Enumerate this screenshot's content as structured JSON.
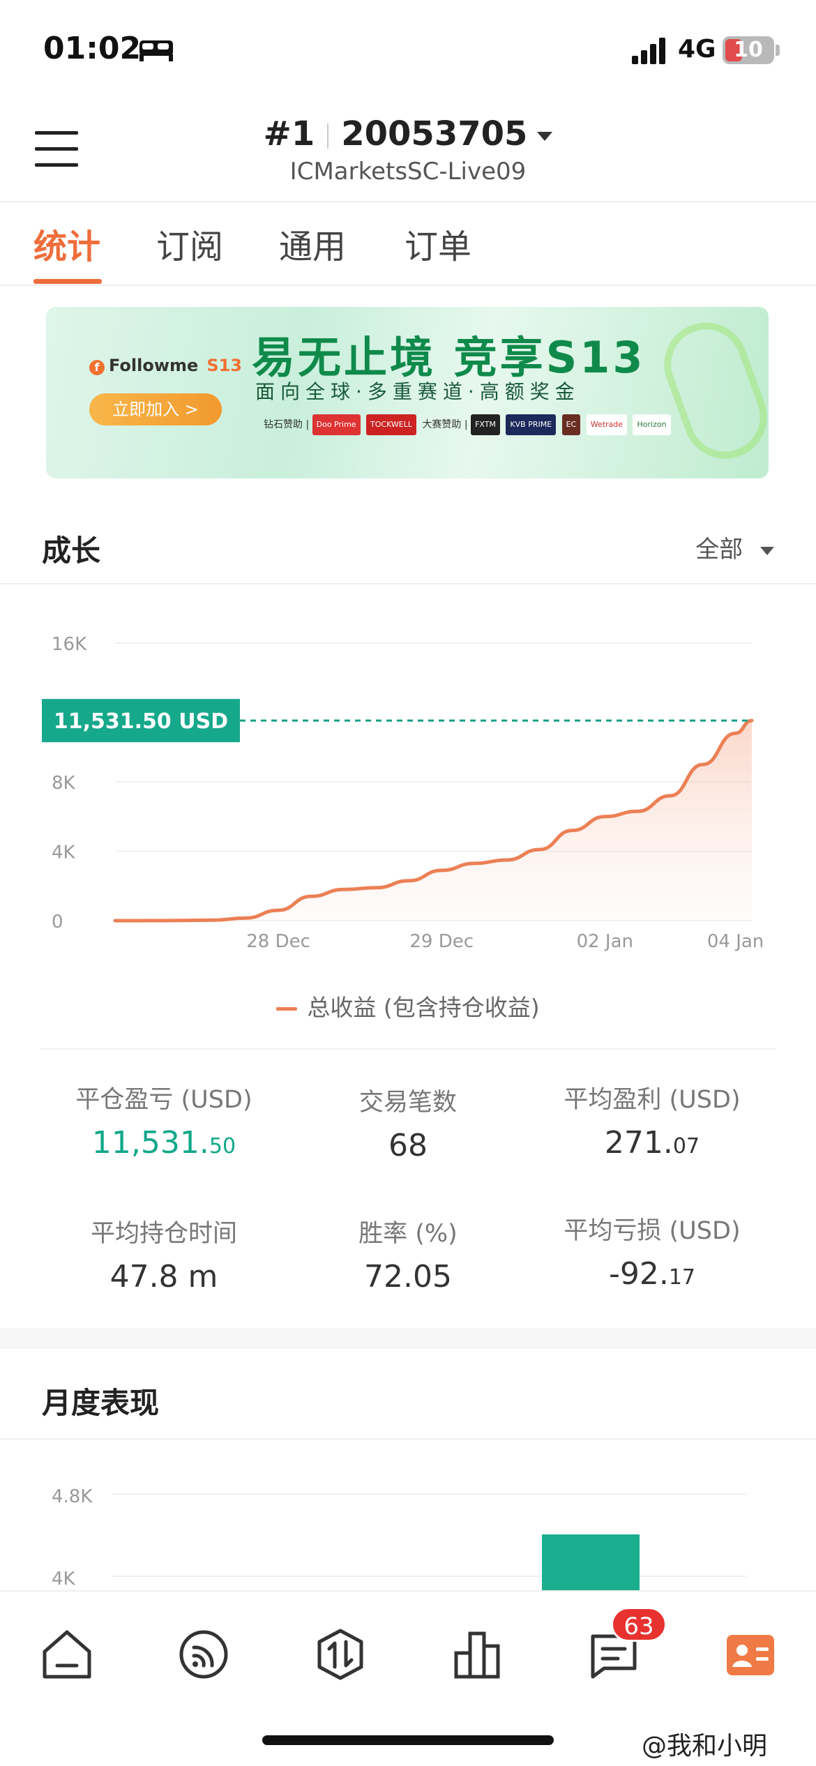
{
  "status_bar": {
    "time": "01:02",
    "network": "4G",
    "battery": "10"
  },
  "header": {
    "rank": "#1",
    "account": "20053705",
    "server": "ICMarketsSC-Live09"
  },
  "tabs": [
    {
      "label": "统计",
      "active": true
    },
    {
      "label": "订阅",
      "active": false
    },
    {
      "label": "通用",
      "active": false
    },
    {
      "label": "订单",
      "active": false
    }
  ],
  "banner": {
    "logo": "Followme",
    "season": "S13",
    "join_label": "立即加入 >",
    "title": "易无止境 竞享S13",
    "subtitle": "面向全球·多重赛道·高额奖金",
    "sponsor_diamond": "钻石赞助",
    "sponsor_main": "大赛赞助",
    "sponsors": [
      "Doo Prime",
      "TOCKWELL",
      "FXTM",
      "KVB PRIME",
      "EC",
      "Wetrade",
      "Horizon"
    ]
  },
  "growth": {
    "title": "成长",
    "filter": "全部",
    "current_label": "11,531.50 USD",
    "legend": "总收益 (包含持仓收益)"
  },
  "chart_data": {
    "type": "area",
    "series": [
      {
        "name": "总收益 (包含持仓收益)",
        "color": "#ec8055",
        "points": [
          [
            0,
            0
          ],
          [
            0.3,
            5
          ],
          [
            0.6,
            30
          ],
          [
            0.8,
            150
          ],
          [
            1.0,
            600
          ],
          [
            1.2,
            1400
          ],
          [
            1.4,
            1800
          ],
          [
            1.6,
            1900
          ],
          [
            1.8,
            2300
          ],
          [
            2.0,
            2900
          ],
          [
            2.2,
            3300
          ],
          [
            2.4,
            3500
          ],
          [
            2.6,
            4100
          ],
          [
            2.8,
            5200
          ],
          [
            3.0,
            6000
          ],
          [
            3.2,
            6300
          ],
          [
            3.4,
            7200
          ],
          [
            3.6,
            9000
          ],
          [
            3.8,
            10800
          ],
          [
            3.9,
            11531.5
          ]
        ]
      }
    ],
    "x_ticks": [
      "28 Dec",
      "29 Dec",
      "02 Jan",
      "04 Jan"
    ],
    "y_ticks": [
      "16K",
      "8K",
      "4K",
      "0"
    ],
    "ylim": [
      0,
      16000
    ],
    "current_value": 11531.5,
    "grid": true
  },
  "stats": [
    {
      "label": "平仓盈亏 (USD)",
      "int": "11,531.",
      "dec": "50",
      "highlight": true
    },
    {
      "label": "交易笔数",
      "int": "68",
      "dec": "",
      "highlight": false
    },
    {
      "label": "平均盈利 (USD)",
      "int": "271.",
      "dec": "07",
      "highlight": false
    },
    {
      "label": "平均持仓时间",
      "int": "47.8 m",
      "dec": "",
      "highlight": false
    },
    {
      "label": "胜率 (%)",
      "int": "72.05",
      "dec": "",
      "highlight": false
    },
    {
      "label": "平均亏损 (USD)",
      "int": "-92.",
      "dec": "17",
      "highlight": false
    }
  ],
  "monthly": {
    "title": "月度表现",
    "y_ticks": [
      "4.8K",
      "4K"
    ],
    "bar_color": "#1aae8f"
  },
  "nav": {
    "badge": "63",
    "items": [
      "home-icon",
      "feed-icon",
      "trade-icon",
      "ranking-icon",
      "messages-icon",
      "profile-icon"
    ]
  },
  "watermark": "@我和小明",
  "colors": {
    "accent": "#ee6d3a",
    "positive": "#12a88a",
    "line": "#ec8055"
  }
}
